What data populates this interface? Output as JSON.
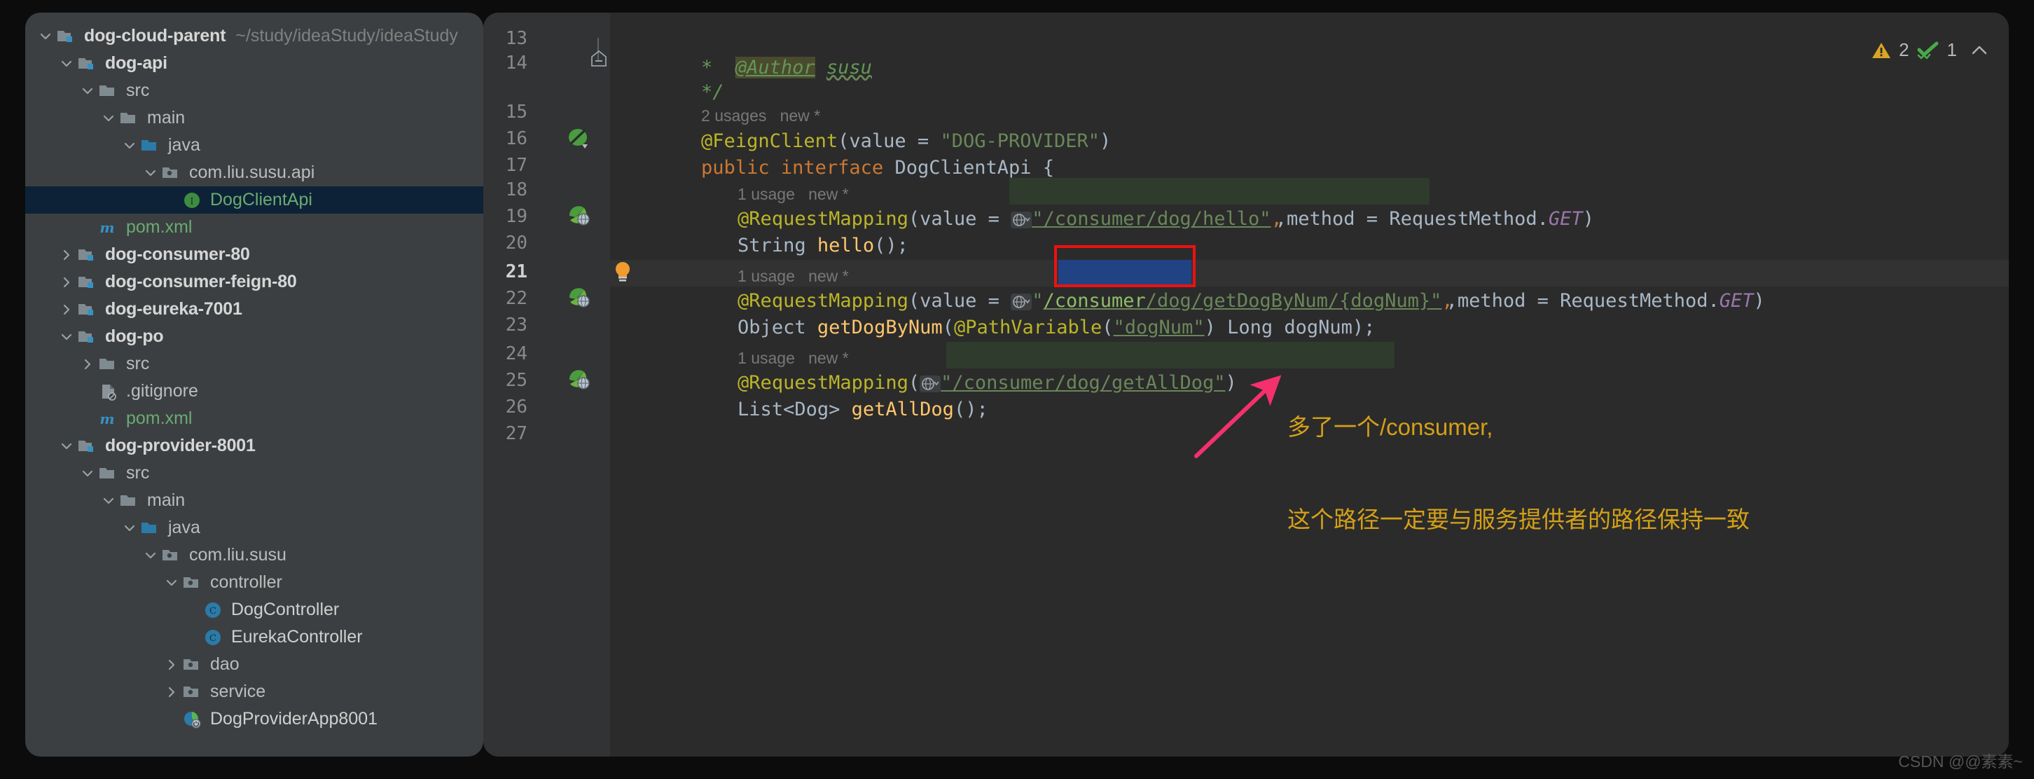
{
  "project": {
    "root_label": "dog-cloud-parent",
    "root_path": "~/study/ideaStudy/ideaStudy",
    "items": [
      {
        "label": "dog-api",
        "indent": 1,
        "arrow": "down",
        "icon": "module-icon",
        "style": "bold"
      },
      {
        "label": "src",
        "indent": 2,
        "arrow": "down",
        "icon": "folder-icon",
        "style": "plain"
      },
      {
        "label": "main",
        "indent": 3,
        "arrow": "down",
        "icon": "folder-icon",
        "style": "plain"
      },
      {
        "label": "java",
        "indent": 4,
        "arrow": "down",
        "icon": "source-root-icon",
        "style": "plain"
      },
      {
        "label": "com.liu.susu.api",
        "indent": 5,
        "arrow": "down",
        "icon": "package-icon",
        "style": "plain"
      },
      {
        "label": "DogClientApi",
        "indent": 6,
        "arrow": "none",
        "icon": "interface-icon",
        "style": "green",
        "selected": true
      },
      {
        "label": "pom.xml",
        "indent": 2,
        "arrow": "none",
        "icon": "maven-icon",
        "style": "green"
      },
      {
        "label": "dog-consumer-80",
        "indent": 1,
        "arrow": "right",
        "icon": "module-icon",
        "style": "bold"
      },
      {
        "label": "dog-consumer-feign-80",
        "indent": 1,
        "arrow": "right",
        "icon": "module-icon",
        "style": "bold"
      },
      {
        "label": "dog-eureka-7001",
        "indent": 1,
        "arrow": "right",
        "icon": "module-icon",
        "style": "bold"
      },
      {
        "label": "dog-po",
        "indent": 1,
        "arrow": "down",
        "icon": "module-icon",
        "style": "bold"
      },
      {
        "label": "src",
        "indent": 2,
        "arrow": "right",
        "icon": "folder-icon",
        "style": "plain"
      },
      {
        "label": ".gitignore",
        "indent": 2,
        "arrow": "none",
        "icon": "gitignore-icon",
        "style": "plain"
      },
      {
        "label": "pom.xml",
        "indent": 2,
        "arrow": "none",
        "icon": "maven-icon",
        "style": "green"
      },
      {
        "label": "dog-provider-8001",
        "indent": 1,
        "arrow": "down",
        "icon": "module-icon",
        "style": "bold"
      },
      {
        "label": "src",
        "indent": 2,
        "arrow": "down",
        "icon": "folder-icon",
        "style": "plain"
      },
      {
        "label": "main",
        "indent": 3,
        "arrow": "down",
        "icon": "folder-icon",
        "style": "plain"
      },
      {
        "label": "java",
        "indent": 4,
        "arrow": "down",
        "icon": "source-root-icon",
        "style": "plain"
      },
      {
        "label": "com.liu.susu",
        "indent": 5,
        "arrow": "down",
        "icon": "package-icon",
        "style": "plain"
      },
      {
        "label": "controller",
        "indent": 6,
        "arrow": "down",
        "icon": "package-icon",
        "style": "plain"
      },
      {
        "label": "DogController",
        "indent": 7,
        "arrow": "none",
        "icon": "class-icon",
        "style": "white"
      },
      {
        "label": "EurekaController",
        "indent": 7,
        "arrow": "none",
        "icon": "class-icon",
        "style": "white"
      },
      {
        "label": "dao",
        "indent": 6,
        "arrow": "right",
        "icon": "package-icon",
        "style": "plain"
      },
      {
        "label": "service",
        "indent": 6,
        "arrow": "right",
        "icon": "package-icon",
        "style": "plain"
      },
      {
        "label": "DogProviderApp8001",
        "indent": 6,
        "arrow": "none",
        "icon": "spring-app-icon",
        "style": "white"
      }
    ]
  },
  "editor": {
    "line_numbers": [
      "13",
      "14",
      "15",
      "16",
      "17",
      "18",
      "19",
      "20",
      "21",
      "22",
      "23",
      "24",
      "25",
      "26",
      "27"
    ],
    "current_line": "21",
    "gutter_icons": [
      {
        "line": "16",
        "name": "spring-bean-gutter-icon"
      },
      {
        "line": "19",
        "name": "spring-mapping-gutter-icon"
      },
      {
        "line": "22",
        "name": "spring-mapping-gutter-icon"
      },
      {
        "line": "25",
        "name": "spring-mapping-gutter-icon"
      }
    ],
    "intention_bulb": {
      "name": "intention-bulb-icon",
      "line": "21"
    },
    "code": {
      "javadoc_star": "*",
      "javadoc_tag": "@Author",
      "javadoc_author": "susu",
      "javadoc_end": "*/",
      "usages_class": "2 usages",
      "new_marker": "new *",
      "feign_anno": "@FeignClient",
      "feign_open": "(value = ",
      "feign_value": "\"DOG-PROVIDER\"",
      "feign_close": ")",
      "kw_public": "public",
      "kw_interface": "interface",
      "type_name": "DogClientApi",
      "brace_open": "{",
      "usages_one": "1 usage",
      "rm_anno": "@RequestMapping",
      "rm_open_value": "(value = ",
      "rm_open_plain": "(",
      "url_hello": "\"/consumer/dog/hello\"",
      "rm_method_part": ",method = RequestMethod.",
      "rm_get": "GET",
      "rm_close": ")",
      "sig_hello_type": "String",
      "sig_hello_name": "hello",
      "sig_hello_tail": "();",
      "url_getdog_prefix": "\"",
      "url_getdog_sel": "/consumer",
      "url_getdog_rest": "/dog/getDogByNum/{dogNum}\"",
      "sig_getdog_type": "Object",
      "sig_getdog_name": "getDogByNum",
      "sig_getdog_paren": "(",
      "sig_getdog_anno": "@PathVariable",
      "sig_getdog_argstr": "\"dogNum\"",
      "sig_getdog_tail": ") Long dogNum);",
      "url_getall": "\"/consumer/dog/getAllDog\"",
      "sig_getall_type": "List<Dog>",
      "sig_getall_name": "getAllDog",
      "sig_getall_tail": "();"
    }
  },
  "annotation": {
    "line1": "多了一个/consumer,",
    "line2": "这个路径一定要与服务提供者的路径保持一致",
    "arrow_name": "pink-pointer-arrow",
    "highlight_box_name": "red-highlight-box",
    "color": "#d4a017",
    "arrow_color": "#f4306d",
    "box_color": "#ee1111"
  },
  "inspections": {
    "warning_count": "2",
    "ok_count": "1",
    "warning_icon": "warning-triangle-icon",
    "ok_icon": "inspection-ok-icon",
    "collapse_icon": "chevron-up-icon"
  },
  "watermark": "CSDN @@素素~",
  "colors": {
    "editor_bg": "#2b2b2b",
    "gutter_bg": "#313335",
    "panel_bg": "#3c3f41",
    "selection_blue": "#214283",
    "selected_row": "#0d2236",
    "string_green": "#6a8759",
    "annotation_yellow": "#bbb529",
    "keyword_orange": "#cc7832"
  }
}
